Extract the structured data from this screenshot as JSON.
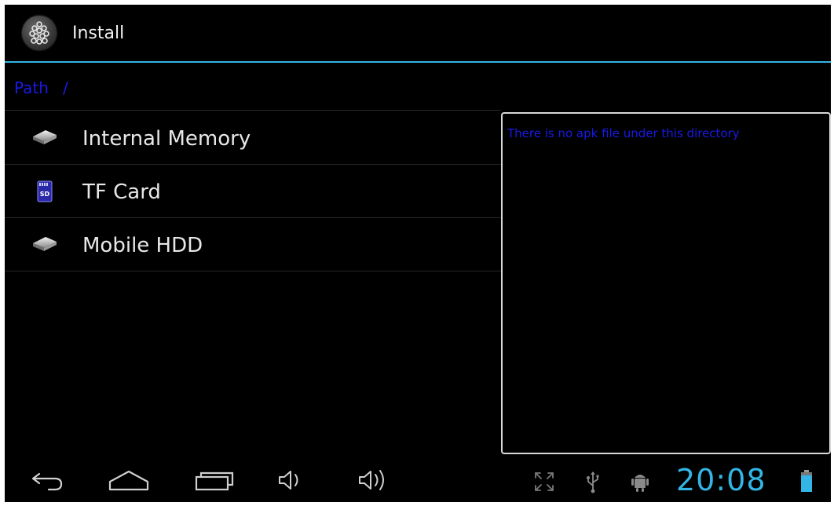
{
  "action_bar": {
    "title": "Install",
    "app_icon": "installer-app-icon",
    "accent_color": "#33b5e5"
  },
  "path_bar": {
    "label": "Path",
    "value": "/",
    "color": "#1a1ae6"
  },
  "storage_list": {
    "items": [
      {
        "label": "Internal Memory",
        "icon": "drive-icon"
      },
      {
        "label": "TF Card",
        "icon": "sd-card-icon"
      },
      {
        "label": "Mobile HDD",
        "icon": "drive-icon"
      }
    ]
  },
  "apk_panel": {
    "message": "There is no apk file under this directory"
  },
  "system_bar": {
    "buttons": [
      {
        "name": "back-button",
        "icon": "back-arrow-icon"
      },
      {
        "name": "home-button",
        "icon": "home-icon"
      },
      {
        "name": "recent-apps-button",
        "icon": "recent-apps-icon"
      },
      {
        "name": "volume-down-button",
        "icon": "volume-down-icon"
      },
      {
        "name": "volume-up-button",
        "icon": "volume-up-icon"
      }
    ],
    "status_icons": [
      "screen-resize-icon",
      "usb-icon",
      "android-debug-icon",
      "battery-icon"
    ],
    "clock": "20:08",
    "clock_color": "#33b5e5"
  }
}
